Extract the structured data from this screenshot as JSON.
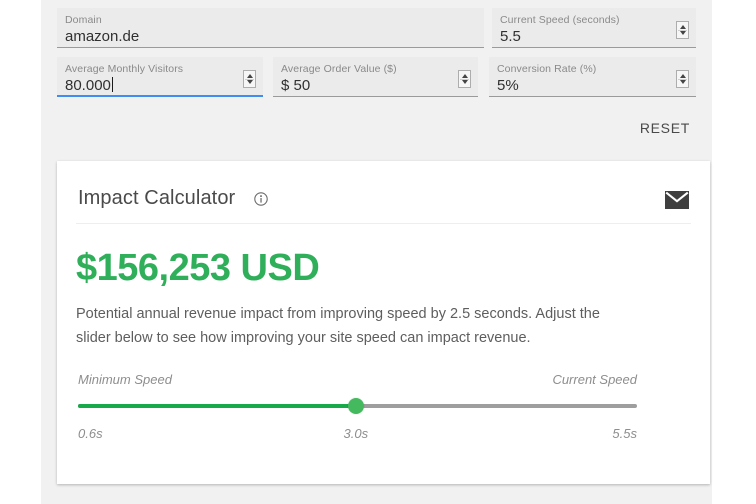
{
  "form": {
    "fields": [
      {
        "id": "domain",
        "label": "Domain",
        "value": "amazon.de",
        "spinner": false,
        "focused": false,
        "caret": false
      },
      {
        "id": "speed",
        "label": "Current Speed (seconds)",
        "value": "5.5",
        "spinner": true,
        "focused": false,
        "caret": false
      },
      {
        "id": "visitors",
        "label": "Average Monthly Visitors",
        "value": "80.000",
        "spinner": true,
        "focused": true,
        "caret": true
      },
      {
        "id": "order",
        "label": "Average Order Value ($)",
        "value": "$ 50",
        "spinner": true,
        "focused": false,
        "caret": false
      },
      {
        "id": "conv",
        "label": "Conversion Rate (%)",
        "value": "5%",
        "spinner": true,
        "focused": false,
        "caret": false
      }
    ],
    "reset_label": "RESET"
  },
  "card": {
    "title": "Impact Calculator",
    "info_icon": "info-icon",
    "mail_icon": "envelope-icon",
    "revenue": "$156,253 USD",
    "revenue_color": "#2faf5a",
    "description": "Potential annual revenue impact from improving speed by 2.5 seconds. Adjust the slider below to see how improving your site speed can impact revenue.",
    "slider": {
      "left_label": "Minimum Speed",
      "right_label": "Current Speed",
      "min_tick": "0.6s",
      "mid_tick": "3.0s",
      "max_tick": "5.5s",
      "min_value": 0.6,
      "max_value": 5.5,
      "current_value": 3.0,
      "fill_percent": "49.7%",
      "fill_color": "#18a94b",
      "track_color": "#9e9e9e"
    }
  }
}
